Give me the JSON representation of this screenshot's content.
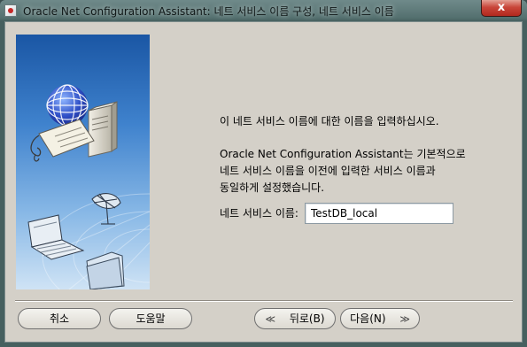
{
  "window": {
    "title": "Oracle Net Configuration Assistant: 네트 서비스 이름 구성, 네트 서비스 이름",
    "close_symbol": "x"
  },
  "content": {
    "instruction_line1": "이 네트 서비스 이름에 대한 이름을 입력하십시오.",
    "instruction_line2": "Oracle Net Configuration Assistant는 기본적으로",
    "instruction_line3": "네트 서비스 이름을 이전에 입력한 서비스 이름과",
    "instruction_line4": "동일하게 설정했습니다.",
    "field_label": "네트 서비스 이름:",
    "field_value": "TestDB_local"
  },
  "buttons": {
    "cancel": "취소",
    "help": "도움말",
    "back": "뒤로(B)",
    "next": "다음(N)",
    "back_arrow": "≪",
    "next_arrow": "≫"
  },
  "icons": [
    "app-icon",
    "close-icon",
    "globe-icon",
    "server-icon",
    "tag-icon",
    "antenna-icon",
    "laptop-icon",
    "folder-icon",
    "back-arrow-icon",
    "next-arrow-icon"
  ],
  "colors": {
    "dialog_background": "#d4d0c8",
    "banner_top": "#1e5aa8",
    "banner_bottom": "#c6def4",
    "titlebar": "#5f7b7b",
    "close_button": "#c9463a"
  }
}
